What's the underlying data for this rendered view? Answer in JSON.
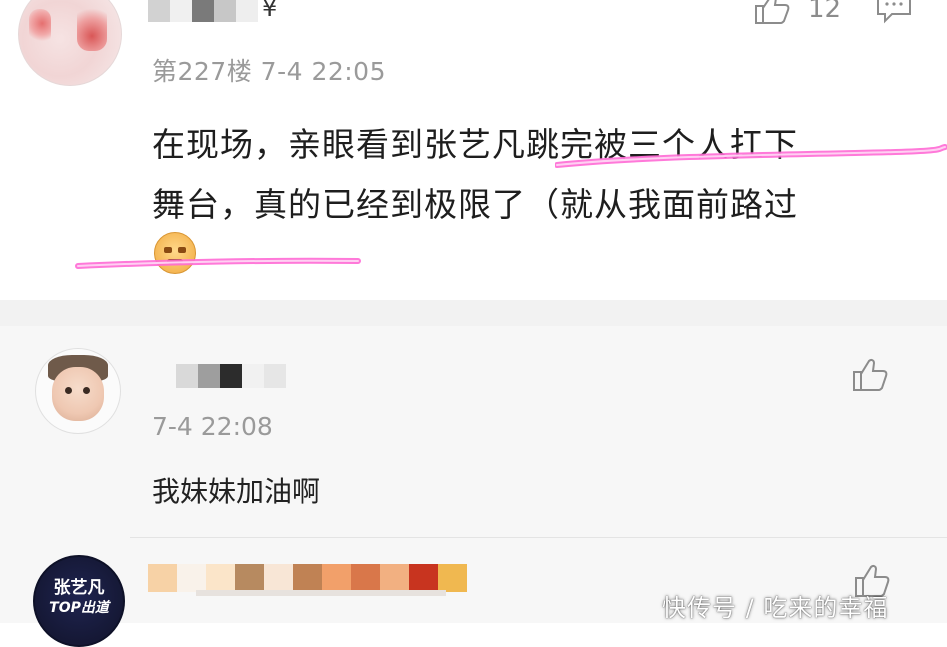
{
  "post": {
    "username_tail": "¥",
    "floor_time": "第227楼  7-4 22:05",
    "like_count": "12",
    "text_line1": "在现场，亲眼看到张艺凡跳完被三个人扛下",
    "text_line2": "舞台，真的已经到极限了（就从我面前路过",
    "emoji": "crying-laugh-emoji"
  },
  "reply1": {
    "time": "7-4 22:08",
    "text": "我妹妹加油啊"
  },
  "reply2": {
    "avatar_line1": "张艺凡",
    "avatar_line2": "TOP出道"
  },
  "watermark": "快传号 / 吃来的幸福",
  "colors": {
    "highlight_pink": "#ff6ad5",
    "meta_gray": "#9a9a9a",
    "divider": "#f2f2f2",
    "reply_bg": "#f7f7f7"
  },
  "mosaics": {
    "username1": [
      "#d2d2d2",
      "#f0f0f0",
      "#7a7a7a",
      "#c7c7c7",
      "#eeeeee"
    ],
    "username2": [
      "#d9d9d9",
      "#9e9e9e",
      "#2c2c2c",
      "#f1f1f1",
      "#e6e6e6"
    ],
    "username3": [
      "#f7d2a6",
      "#f9f2ea",
      "#fbe5c9",
      "#b78a60",
      "#f8e6d6",
      "#c08254",
      "#f2a06a",
      "#d9774a",
      "#f2b081",
      "#c8341f",
      "#f0b850"
    ]
  }
}
